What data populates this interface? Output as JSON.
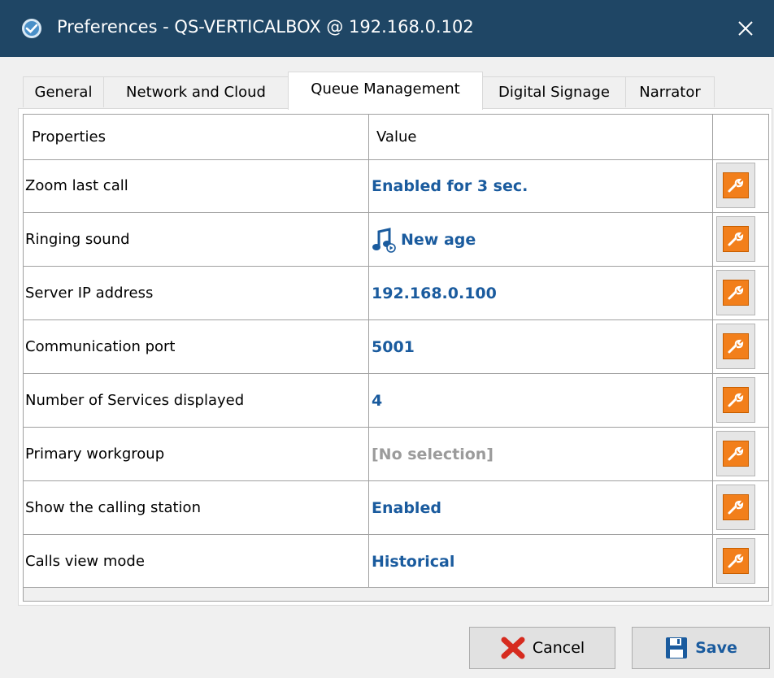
{
  "window": {
    "title": "Preferences - QS-VERTICALBOX @ 192.168.0.102",
    "close_label": "✕"
  },
  "tabs": [
    {
      "label": "General",
      "active": false
    },
    {
      "label": "Network and Cloud",
      "active": false
    },
    {
      "label": "Queue Management",
      "active": true
    },
    {
      "label": "Digital Signage",
      "active": false
    },
    {
      "label": "Narrator",
      "active": false
    }
  ],
  "grid": {
    "headers": {
      "property": "Properties",
      "value": "Value"
    },
    "rows": [
      {
        "property": "Zoom last call",
        "value": "Enabled for 3 sec."
      },
      {
        "property": "Ringing sound",
        "value": "New age",
        "value_icon": "music-note-icon"
      },
      {
        "property": "Server IP address",
        "value": "192.168.0.100"
      },
      {
        "property": "Communication port",
        "value": "5001"
      },
      {
        "property": "Number of Services displayed",
        "value": "4"
      },
      {
        "property": "Primary workgroup",
        "value": "[No selection]",
        "muted": true
      },
      {
        "property": "Show the calling station",
        "value": "Enabled"
      },
      {
        "property": "Calls view mode",
        "value": "Historical"
      }
    ]
  },
  "buttons": {
    "cancel": "Cancel",
    "save": "Save"
  },
  "colors": {
    "titlebar": "#1f4665",
    "value_text": "#1a5b9e",
    "muted_text": "#9b9b9b",
    "edit_icon_bg": "#f27f1b",
    "cancel_icon": "#d62b1f"
  },
  "icons": {
    "app": "app-logo-icon",
    "close": "close-icon",
    "edit": "wrench-icon",
    "cancel": "red-x-icon",
    "save": "floppy-disk-icon"
  }
}
